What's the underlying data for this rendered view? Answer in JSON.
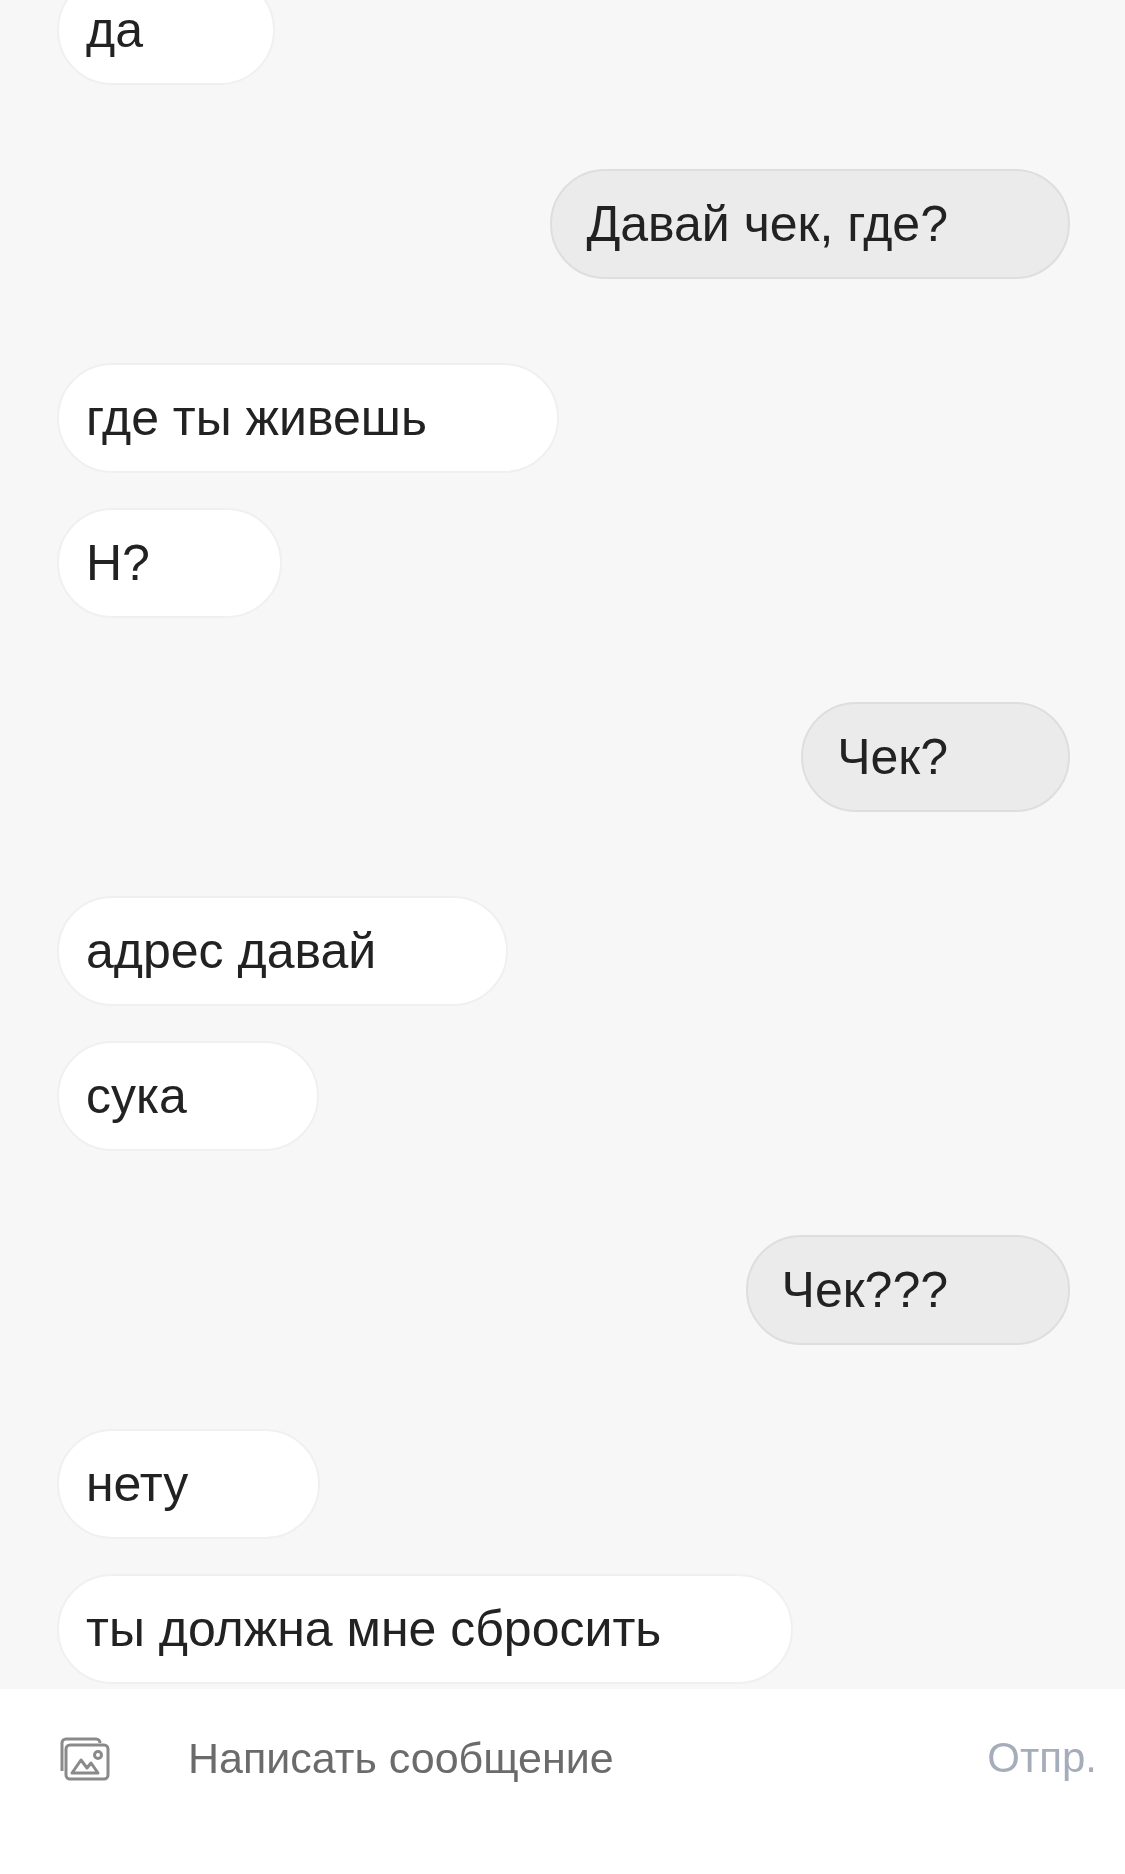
{
  "messages": [
    {
      "outgoing": false,
      "text": "да"
    },
    {
      "outgoing": true,
      "text": "Давай чек, где?"
    },
    {
      "outgoing": false,
      "text": "где ты живешь"
    },
    {
      "outgoing": false,
      "text": "Н?"
    },
    {
      "outgoing": true,
      "text": "Чек?"
    },
    {
      "outgoing": false,
      "text": "адрес давай"
    },
    {
      "outgoing": false,
      "text": "сука"
    },
    {
      "outgoing": true,
      "text": "Чек???"
    },
    {
      "outgoing": false,
      "text": "нету"
    },
    {
      "outgoing": false,
      "text": "ты должна мне сбросить"
    }
  ],
  "composer": {
    "placeholder": "Написать сообщение",
    "send_label": "Отпр.",
    "send_disabled": true
  }
}
